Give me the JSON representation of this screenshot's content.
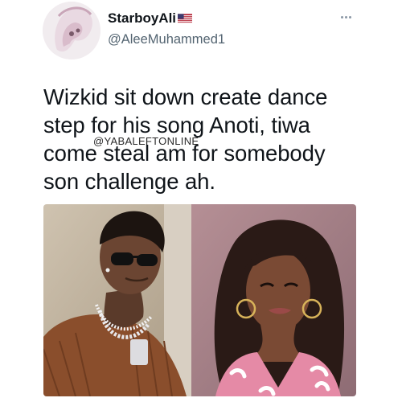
{
  "tweet": {
    "author": {
      "display_name": "StarboyAli",
      "handle": "@AleeMuhammed1",
      "badge_icon": "us-flag-icon"
    },
    "text": "Wizkid sit down create dance\nstep for his song Anoti, tiwa\ncome steal am for somebody\nson challenge ah.",
    "watermark": "@YABALEFTONLINE",
    "more_icon": "more-options-icon",
    "media": [
      {
        "icon": "photo-man-sunglasses"
      },
      {
        "icon": "photo-woman-pink-outfit"
      }
    ]
  },
  "colors": {
    "text": "#0f1419",
    "secondary": "#536471",
    "background": "#ffffff"
  }
}
